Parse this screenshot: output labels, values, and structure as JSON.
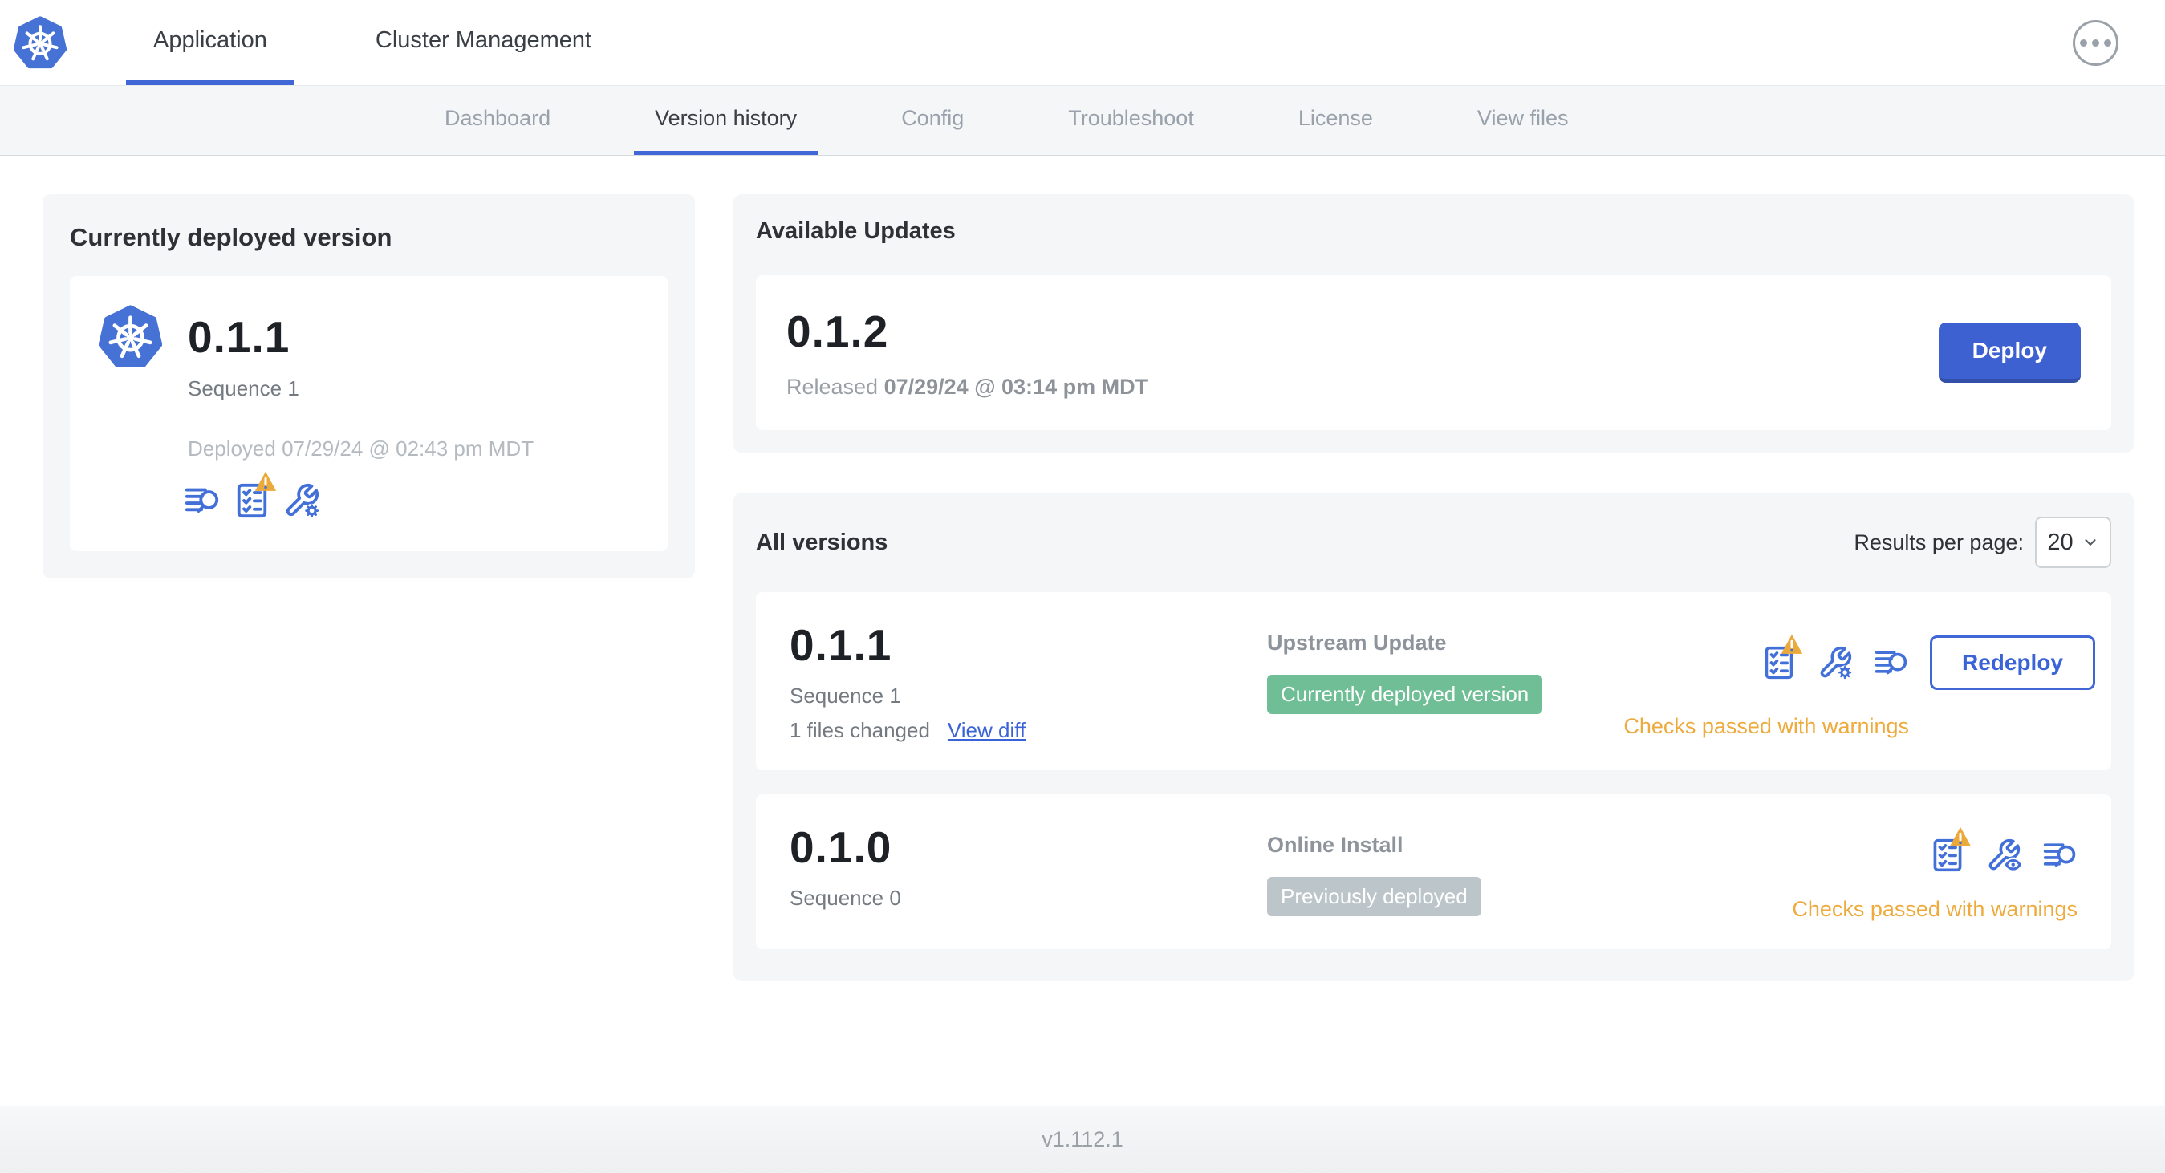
{
  "header": {
    "tabs": [
      {
        "label": "Application",
        "active": true
      },
      {
        "label": "Cluster Management",
        "active": false
      }
    ]
  },
  "nav": {
    "tabs": [
      {
        "label": "Dashboard",
        "active": false
      },
      {
        "label": "Version history",
        "active": true
      },
      {
        "label": "Config",
        "active": false
      },
      {
        "label": "Troubleshoot",
        "active": false
      },
      {
        "label": "License",
        "active": false
      },
      {
        "label": "View files",
        "active": false
      }
    ]
  },
  "current_version": {
    "title": "Currently deployed version",
    "version": "0.1.1",
    "sequence": "Sequence 1",
    "deployed": "Deployed 07/29/24 @ 02:43 pm MDT",
    "icons": [
      "logs-icon",
      "preflight-checks-warning-icon",
      "edit-config-icon"
    ]
  },
  "available_updates": {
    "title": "Available Updates",
    "version": "0.1.2",
    "released_prefix": "Released",
    "released_date": "07/29/24 @ 03:14 pm MDT",
    "deploy_label": "Deploy"
  },
  "all_versions": {
    "title": "All versions",
    "results_per_page_label": "Results per page:",
    "results_per_page_value": "20",
    "rows": [
      {
        "version": "0.1.1",
        "sequence": "Sequence 1",
        "files_changed": "1 files changed",
        "view_diff_label": "View diff",
        "source": "Upstream Update",
        "badge": "Currently deployed version",
        "badge_style": "green",
        "action_label": "Redeploy",
        "status": "Checks passed with warnings",
        "icons": [
          "preflight-checks-warning-icon",
          "edit-config-icon",
          "logs-icon"
        ]
      },
      {
        "version": "0.1.0",
        "sequence": "Sequence 0",
        "source": "Online Install",
        "badge": "Previously deployed",
        "badge_style": "gray",
        "status": "Checks passed with warnings",
        "icons": [
          "preflight-checks-warning-icon",
          "view-config-icon",
          "logs-icon"
        ]
      }
    ]
  },
  "footer": {
    "app_version": "v1.112.1"
  },
  "colors": {
    "accent_blue": "#4167D6",
    "deploy_button": "#3E61D2",
    "green_badge": "#6FBE96",
    "gray_badge": "#BCC5C9",
    "warning_triangle": "#ECA93B",
    "status_orange": "#EDAA3D",
    "panel_background": "#F4F6F8"
  }
}
